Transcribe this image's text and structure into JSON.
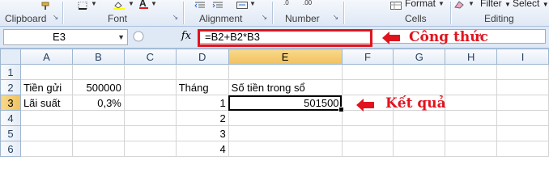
{
  "ribbon": {
    "groups": {
      "clipboard": "Clipboard",
      "font": "Font",
      "alignment": "Alignment",
      "number": "Number",
      "cells": "Cells",
      "editing": "Editing"
    },
    "buttons": {
      "format": "Format",
      "filter": "Filter",
      "select": "Select"
    }
  },
  "formula_bar": {
    "name_box": "E3",
    "formula": "=B2+B2*B3"
  },
  "columns": [
    "A",
    "B",
    "C",
    "D",
    "E",
    "F",
    "G",
    "H",
    "I"
  ],
  "rows": [
    {
      "num": "1",
      "cells": [
        "",
        "",
        "",
        "",
        "",
        "",
        "",
        "",
        ""
      ]
    },
    {
      "num": "2",
      "cells": [
        "Tiền gửi",
        "500000",
        "",
        "Tháng",
        "Số tiền trong sổ",
        "",
        "",
        "",
        ""
      ]
    },
    {
      "num": "3",
      "cells": [
        "Lãi suất",
        "0,3%",
        "",
        "1",
        "501500",
        "",
        "",
        "",
        ""
      ]
    },
    {
      "num": "4",
      "cells": [
        "",
        "",
        "",
        "2",
        "",
        "",
        "",
        "",
        ""
      ]
    },
    {
      "num": "5",
      "cells": [
        "",
        "",
        "",
        "3",
        "",
        "",
        "",
        "",
        ""
      ]
    },
    {
      "num": "6",
      "cells": [
        "",
        "",
        "",
        "4",
        "",
        "",
        "",
        "",
        ""
      ]
    }
  ],
  "annotations": {
    "formula_label": "Công thức",
    "result_label": "Kết quả"
  },
  "colors": {
    "annotation": "#e0141e",
    "active_header": "#f1c15f"
  }
}
